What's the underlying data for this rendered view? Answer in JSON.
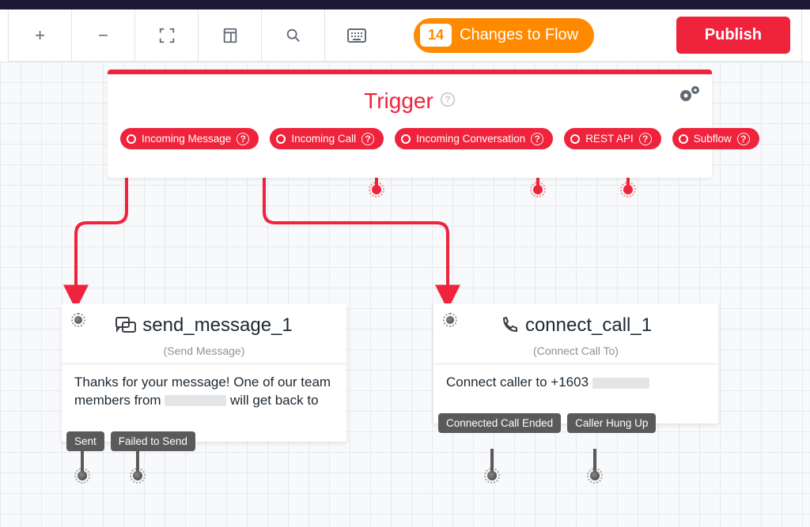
{
  "toolbar": {
    "changes_count": "14",
    "changes_label": "Changes to Flow",
    "publish_label": "Publish",
    "icons": {
      "zoom_in": "plus-icon",
      "zoom_out": "minus-icon",
      "fit": "fullscreen-icon",
      "notes": "note-icon",
      "search": "search-icon",
      "keyboard": "keyboard-icon"
    }
  },
  "trigger": {
    "title": "Trigger",
    "outputs": [
      {
        "label": "Incoming Message"
      },
      {
        "label": "Incoming Call"
      },
      {
        "label": "Incoming Conversation"
      },
      {
        "label": "REST API"
      },
      {
        "label": "Subflow"
      }
    ]
  },
  "nodes": {
    "send_message": {
      "title": "send_message_1",
      "subtitle": "(Send Message)",
      "body_pre": "Thanks for your message! One of our team members from ",
      "body_post": " will get back to",
      "outputs": [
        "Sent",
        "Failed to Send"
      ]
    },
    "connect_call": {
      "title": "connect_call_1",
      "subtitle": "(Connect Call To)",
      "body_pre": "Connect caller to +1603",
      "outputs": [
        "Connected Call Ended",
        "Caller Hung Up"
      ]
    }
  },
  "colors": {
    "accent": "#ef233c",
    "orange": "#ff8a00"
  }
}
